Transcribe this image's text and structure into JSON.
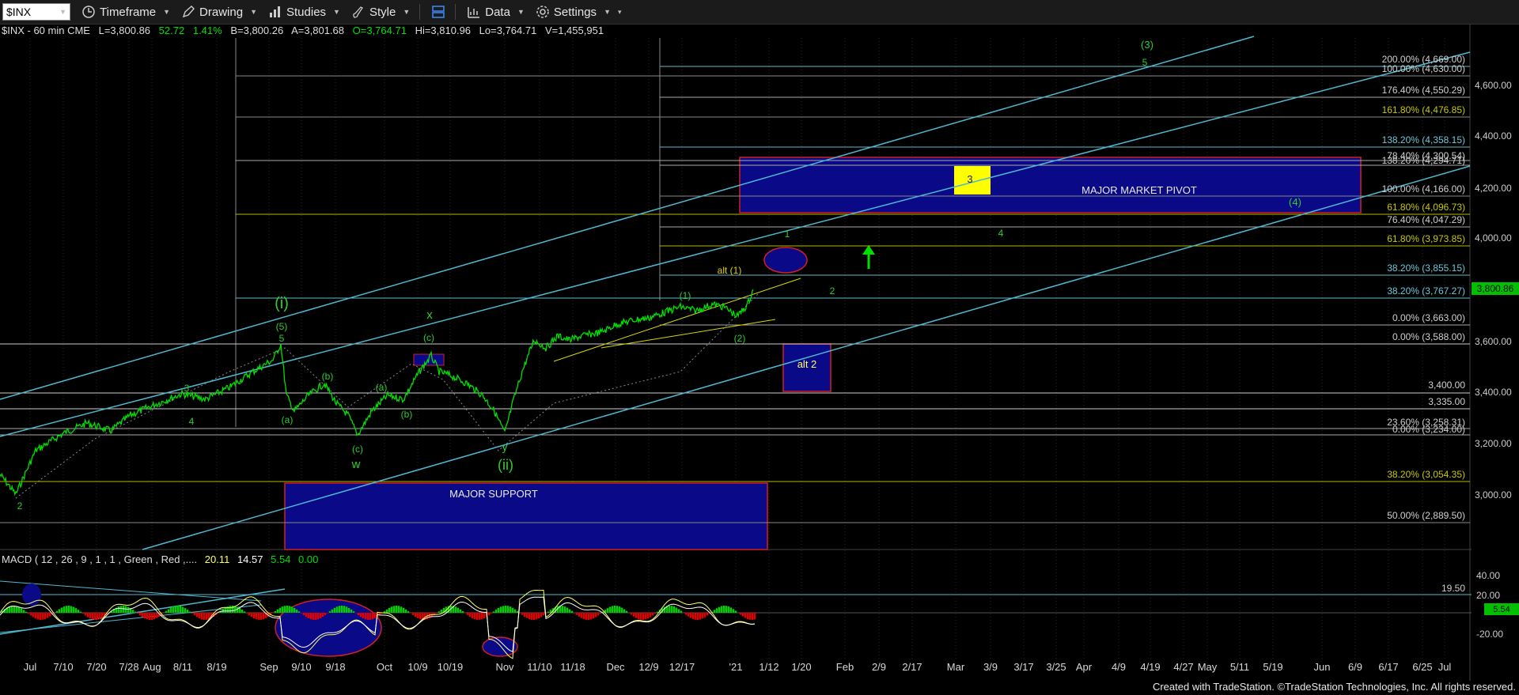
{
  "toolbar": {
    "symbol": "$INX",
    "timeframe": "Timeframe",
    "drawing": "Drawing",
    "studies": "Studies",
    "style": "Style",
    "data": "Data",
    "settings": "Settings"
  },
  "infoline": {
    "symbol": "$INX - 60 min  CME",
    "last": "L=3,800.86",
    "change": "52.72",
    "pct": "1.41%",
    "bid": "B=3,800.26",
    "ask": "A=3,801.68",
    "open": "O=3,764.71",
    "high": "Hi=3,810.96",
    "low": "Lo=3,764.71",
    "volume": "V=1,455,951"
  },
  "price_axis": {
    "labels": [
      "4,600.00",
      "4,400.00",
      "4,200.00",
      "4,000.00",
      "3,600.00",
      "3,400.00",
      "3,200.00",
      "3,000.00"
    ],
    "last_price": "3,800.86"
  },
  "macd": {
    "title": "MACD ( 12 , 26 , 9 , 1 , 1 , Green , Red ,....",
    "v1": "20.11",
    "v2": "14.57",
    "v3": "5.54",
    "v4": "0.00",
    "axis": [
      "40.00",
      "20.00",
      "-20.00"
    ],
    "level": "19.50",
    "badge": "5.54"
  },
  "date_axis": [
    "Jul",
    "7/10",
    "7/20",
    "7/28",
    "Aug",
    "8/11",
    "8/19",
    "Sep",
    "9/10",
    "9/18",
    "Oct",
    "10/9",
    "10/19",
    "Nov",
    "11/10",
    "11/18",
    "Dec",
    "12/9",
    "12/17",
    "'21",
    "1/12",
    "1/20",
    "Feb",
    "2/9",
    "2/17",
    "Mar",
    "3/9",
    "3/17",
    "3/25",
    "Apr",
    "4/9",
    "4/19",
    "4/27",
    "May",
    "5/11",
    "5/19",
    "Jun",
    "6/9",
    "6/17",
    "6/25",
    "Jul"
  ],
  "fib_labels": [
    "200.00% (4,669.00)",
    "100.00% (4,630.00)",
    "176.40% (4,550.29)",
    "161.80% (4,476.85)",
    "138.20% (4,358.15)",
    "78.40% (4,300.54)",
    "138.20% (4,294.71)",
    "100.00% (4,166.00)",
    "61.80% (4,096.73)",
    "76.40% (4,047.29)",
    "61.80% (3,973.85)",
    "38.20% (3,855.15)",
    "38.20% (3,767.27)",
    "0.00% (3,663.00)",
    "0.00% (3,588.00)",
    "3,400.00",
    "3,335.00",
    "23.60% (3,258.31)",
    "0.00% (3,234.00)",
    "38.20% (3,054.35)",
    "50.00% (2,889.50)"
  ],
  "zones": {
    "pivot": "MAJOR MARKET PIVOT",
    "support": "MAJOR SUPPORT",
    "alt2": "alt 2",
    "box3": "3"
  },
  "wave_labels": {
    "i": "(i)",
    "ii": "(ii)",
    "w": "w",
    "x": "x",
    "y": "y",
    "p5": "(5)",
    "n5": "5",
    "n3": "3",
    "n4": "4",
    "n2": "2",
    "a1": "(a)",
    "b1": "(b)",
    "c1": "(c)",
    "a2": "(a)",
    "b2": "(b)",
    "c2": "(c)",
    "w1": "(1)",
    "w2": "(2)",
    "alt1": "alt (1)",
    "f1": "1",
    "f2": "2",
    "f4": "4",
    "big3": "(3)",
    "big5": "5",
    "big4": "(4)"
  },
  "footer": "Created with TradeStation. ©TradeStation Technologies, Inc. All rights reserved.",
  "colors": {
    "price": "#00e000",
    "fib_cyan": "#5fb7c9",
    "fib_olive": "#b8b800",
    "zone": "#0a0a88",
    "zone_border": "#d02020"
  }
}
